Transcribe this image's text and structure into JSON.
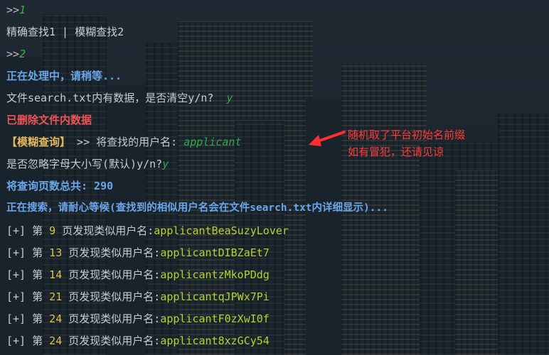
{
  "terminal": {
    "l1": {
      "prompt": ">>",
      "input": "1"
    },
    "l2": {
      "text": "精确查找1 | 模糊查找2"
    },
    "l3": {
      "prompt": ">>",
      "input": "2"
    },
    "l4": {
      "text": "正在处理中，请稍等..."
    },
    "l5": {
      "text": "文件search.txt内有数据，是否清空y/n?",
      "answer": "y"
    },
    "l6": {
      "text": "已删除文件内数据"
    },
    "l7": {
      "tag": "【模糊查询】",
      "text": ">> 将查找的用户名:",
      "input": "applicant"
    },
    "l8": {
      "text": "是否忽略字母大小写(默认)y/n?",
      "answer": "y"
    },
    "l9": {
      "text": "将查询页数总共: 290"
    },
    "l10": {
      "text": "正在搜索，请耐心等候(查找到的相似用户名会在文件search.txt内详细显示)..."
    },
    "results": [
      {
        "prefix": "[+]",
        "pre": "第",
        "page": "9",
        "mid": "页发现类似用户名:",
        "username": "applicantBeaSuzyLover"
      },
      {
        "prefix": "[+]",
        "pre": "第",
        "page": "13",
        "mid": "页发现类似用户名:",
        "username": "applicantDIBZaEt7"
      },
      {
        "prefix": "[+]",
        "pre": "第",
        "page": "14",
        "mid": "页发现类似用户名:",
        "username": "applicantzMkoPDdg"
      },
      {
        "prefix": "[+]",
        "pre": "第",
        "page": "21",
        "mid": "页发现类似用户名:",
        "username": "applicantqJPWx7Pi"
      },
      {
        "prefix": "[+]",
        "pre": "第",
        "page": "24",
        "mid": "页发现类似用户名:",
        "username": "applicantF0zXwI0f"
      },
      {
        "prefix": "[+]",
        "pre": "第",
        "page": "24",
        "mid": "页发现类似用户名:",
        "username": "applicant8xzGCy54"
      }
    ]
  },
  "annotation": {
    "line1": "随机取了平台初始名前缀",
    "line2": "如有冒犯，还请见谅",
    "color": "#ff3a3a"
  }
}
